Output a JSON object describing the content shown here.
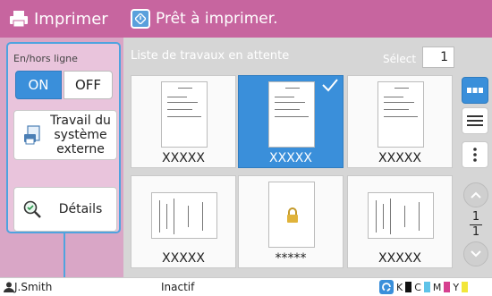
{
  "app": {
    "title": "Imprimer"
  },
  "left": {
    "onoff_label": "En/hors ligne",
    "on_label": "ON",
    "off_label": "OFF",
    "external_job_label": "Travail du système externe",
    "details_label": "Détails"
  },
  "header": {
    "status_text": "Prêt à imprimer."
  },
  "list": {
    "title": "Liste de travaux en attente",
    "select_label": "Sélect",
    "select_count": "1",
    "jobs": [
      {
        "name": "XXXXX",
        "selected": false
      },
      {
        "name": "XXXXX",
        "selected": true
      },
      {
        "name": "XXXXX",
        "selected": false
      },
      {
        "name": "XXXXX",
        "selected": false
      },
      {
        "name": "*****",
        "selected": false,
        "locked": true
      },
      {
        "name": "XXXXX",
        "selected": false
      }
    ]
  },
  "pager": {
    "current": "1",
    "total": "1"
  },
  "footer": {
    "user": "J.Smith",
    "state": "Inactif",
    "inks": [
      "K",
      "C",
      "M",
      "Y"
    ]
  },
  "colors": {
    "accent": "#c7659f",
    "panel": "#d9a6c6",
    "blue": "#3a8fda",
    "ink_k": "#111111",
    "ink_c": "#5ec3e8",
    "ink_m": "#d6408f",
    "ink_y": "#f2e63a"
  }
}
